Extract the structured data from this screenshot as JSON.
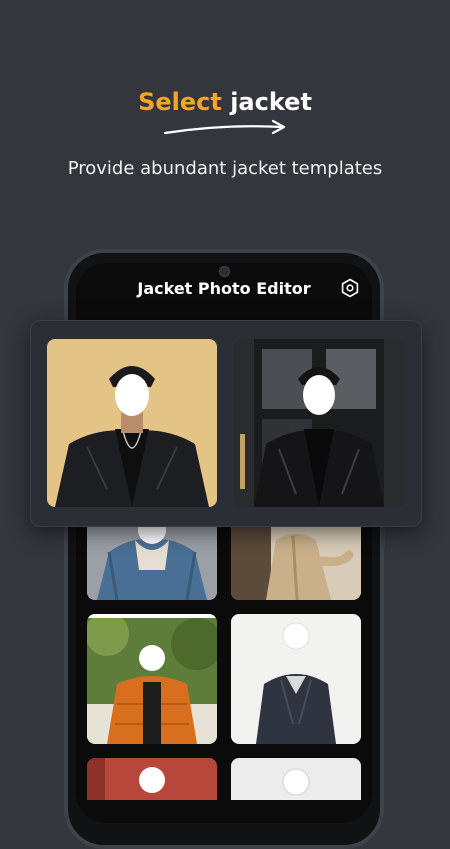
{
  "promo": {
    "headline_accent": "Select",
    "headline_rest": " jacket",
    "subtitle": "Provide abundant jacket templates"
  },
  "app": {
    "title": "Jacket Photo Editor",
    "settings_icon": "settings-icon"
  },
  "templates": [
    {
      "name": "black-leather-jacket-beige"
    },
    {
      "name": "black-leather-jacket-door"
    },
    {
      "name": "denim-jacket"
    },
    {
      "name": "beige-trench-coat"
    },
    {
      "name": "orange-puffer-jacket"
    },
    {
      "name": "navy-wool-coat"
    },
    {
      "name": "red-background-template"
    },
    {
      "name": "light-template"
    }
  ],
  "colors": {
    "background": "#33363c",
    "accent": "#f5a623"
  }
}
